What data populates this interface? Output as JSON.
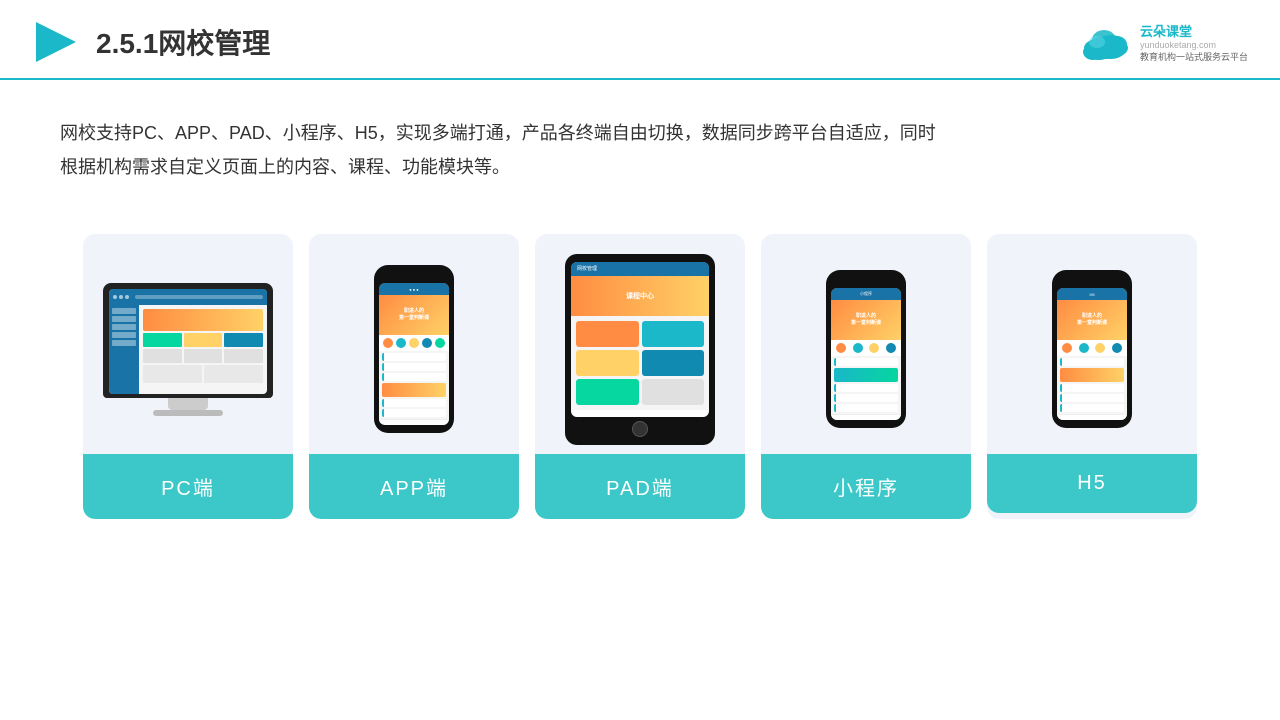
{
  "header": {
    "title": "2.5.1网校管理",
    "logo_name": "云朵课堂",
    "logo_domain": "yunduoketang.com",
    "logo_slogan": "教育机构一站\n式服务云平台"
  },
  "description": {
    "text": "网校支持PC、APP、PAD、小程序、H5，实现多端打通，产品各终端自由切换，数据同步跨平台自适应，同时根据机构需求自定义页面上的内容、课程、功能模块等。"
  },
  "cards": [
    {
      "id": "pc",
      "label": "PC端"
    },
    {
      "id": "app",
      "label": "APP端"
    },
    {
      "id": "pad",
      "label": "PAD端"
    },
    {
      "id": "miniprogram",
      "label": "小程序"
    },
    {
      "id": "h5",
      "label": "H5"
    }
  ],
  "colors": {
    "accent": "#3cc8c8",
    "header_border": "#1ab8c8",
    "text_main": "#333333",
    "card_bg": "#eef1f8",
    "card_label_bg": "#3cc8c8"
  }
}
